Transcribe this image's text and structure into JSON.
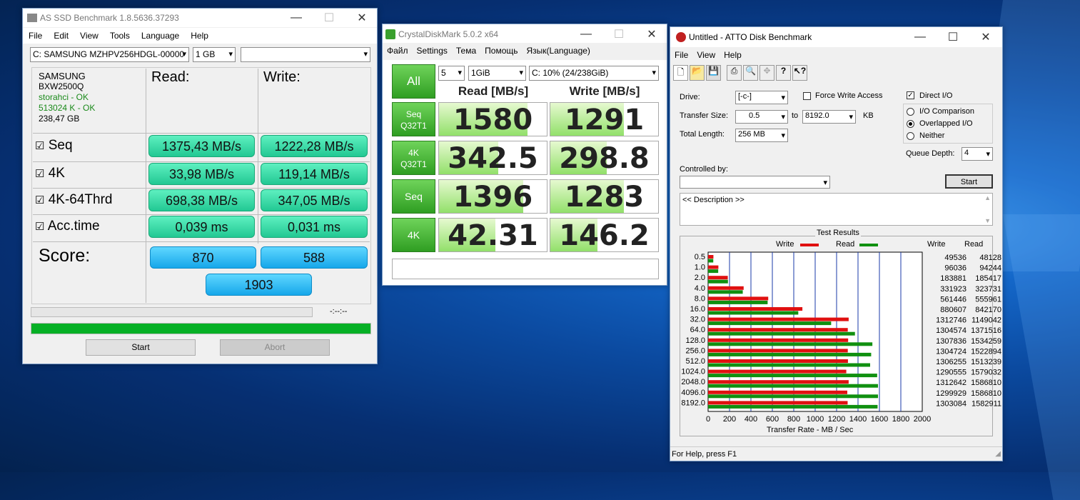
{
  "asssd": {
    "title": "AS SSD Benchmark 1.8.5636.37293",
    "menu": [
      "File",
      "Edit",
      "View",
      "Tools",
      "Language",
      "Help"
    ],
    "drive": "C: SAMSUNG MZHPV256HDGL-00000",
    "size": "1 GB",
    "info": [
      "SAMSUNG",
      "BXW2500Q",
      "storahci - OK",
      "513024 K - OK",
      "238,47 GB"
    ],
    "read_hdr": "Read:",
    "write_hdr": "Write:",
    "rows": [
      {
        "label": "Seq",
        "read": "1375,43 MB/s",
        "write": "1222,28 MB/s"
      },
      {
        "label": "4K",
        "read": "33,98 MB/s",
        "write": "119,14 MB/s"
      },
      {
        "label": "4K-64Thrd",
        "read": "698,38 MB/s",
        "write": "347,05 MB/s"
      },
      {
        "label": "Acc.time",
        "read": "0,039 ms",
        "write": "0,031 ms"
      }
    ],
    "score_label": "Score:",
    "score_read": "870",
    "score_write": "588",
    "score_total": "1903",
    "time": "-:--:--",
    "start": "Start",
    "abort": "Abort",
    "progress": 1.0
  },
  "cdm": {
    "title": "CrystalDiskMark 5.0.2 x64",
    "menu": [
      "Файл",
      "Settings",
      "Тема",
      "Помощь",
      "Язык(Language)"
    ],
    "all": "All",
    "count": "5",
    "size": "1GiB",
    "drive": "C: 10% (24/238GiB)",
    "read_hdr": "Read [MB/s]",
    "write_hdr": "Write [MB/s]",
    "rows": [
      {
        "l1": "Seq",
        "l2": "Q32T1",
        "read": "1580",
        "write": "1291",
        "rf": 0.82,
        "wf": 0.68
      },
      {
        "l1": "4K",
        "l2": "Q32T1",
        "read": "342.5",
        "write": "298.8",
        "rf": 0.55,
        "wf": 0.52
      },
      {
        "l1": "Seq",
        "l2": "",
        "read": "1396",
        "write": "1283",
        "rf": 0.78,
        "wf": 0.68
      },
      {
        "l1": "4K",
        "l2": "",
        "read": "42.31",
        "write": "146.2",
        "rf": 0.52,
        "wf": 0.44
      }
    ]
  },
  "atto": {
    "title": "Untitled - ATTO Disk Benchmark",
    "menu": [
      "File",
      "View",
      "Help"
    ],
    "drive_label": "Drive:",
    "drive": "[-c-]",
    "force_write": "Force Write Access",
    "direct_io": "Direct I/O",
    "transfer_label": "Transfer Size:",
    "ts_from": "0.5",
    "to": "to",
    "ts_to": "8192.0",
    "kb": "KB",
    "length_label": "Total Length:",
    "length": "256 MB",
    "io_comp": "I/O Comparison",
    "overlapped": "Overlapped I/O",
    "neither": "Neither",
    "queue_label": "Queue Depth:",
    "queue": "4",
    "controlled_label": "Controlled by:",
    "start": "Start",
    "description": "<< Description >>",
    "results_title": "Test Results",
    "legend_write": "Write",
    "legend_read": "Read",
    "col_write": "Write",
    "col_read": "Read",
    "xlabel": "Transfer Rate - MB / Sec",
    "status": "For Help, press F1",
    "colors": {
      "write": "#e01010",
      "read": "#109010"
    }
  },
  "chart_data": {
    "type": "bar",
    "orientation": "horizontal",
    "categories": [
      "0.5",
      "1.0",
      "2.0",
      "4.0",
      "8.0",
      "16.0",
      "32.0",
      "64.0",
      "128.0",
      "256.0",
      "512.0",
      "1024.0",
      "2048.0",
      "4096.0",
      "8192.0"
    ],
    "series": [
      {
        "name": "Write",
        "values": [
          49.536,
          96.036,
          183.881,
          331.923,
          561.446,
          880.607,
          1312.746,
          1304.574,
          1307.836,
          1304.724,
          1306.255,
          1290.555,
          1312.642,
          1299.929,
          1303.084
        ],
        "labels": [
          "49536",
          "96036",
          "183881",
          "331923",
          "561446",
          "880607",
          "1312746",
          "1304574",
          "1307836",
          "1304724",
          "1306255",
          "1290555",
          "1312642",
          "1299929",
          "1303084"
        ]
      },
      {
        "name": "Read",
        "values": [
          48.128,
          94.244,
          185.417,
          323.731,
          555.961,
          842.17,
          1149.042,
          1371.516,
          1534.259,
          1522.894,
          1513.239,
          1579.032,
          1586.81,
          1586.81,
          1582.911
        ],
        "labels": [
          "48128",
          "94244",
          "185417",
          "323731",
          "555961",
          "842170",
          "1149042",
          "1371516",
          "1534259",
          "1522894",
          "1513239",
          "1579032",
          "1586810",
          "1586810",
          "1582911"
        ]
      }
    ],
    "xticks": [
      "0",
      "200",
      "400",
      "600",
      "800",
      "1000",
      "1200",
      "1400",
      "1600",
      "1800",
      "2000"
    ],
    "xlim": [
      0,
      2000
    ],
    "xlabel": "Transfer Rate - MB / Sec",
    "title": "Test Results",
    "grid": true,
    "legend": "top"
  }
}
